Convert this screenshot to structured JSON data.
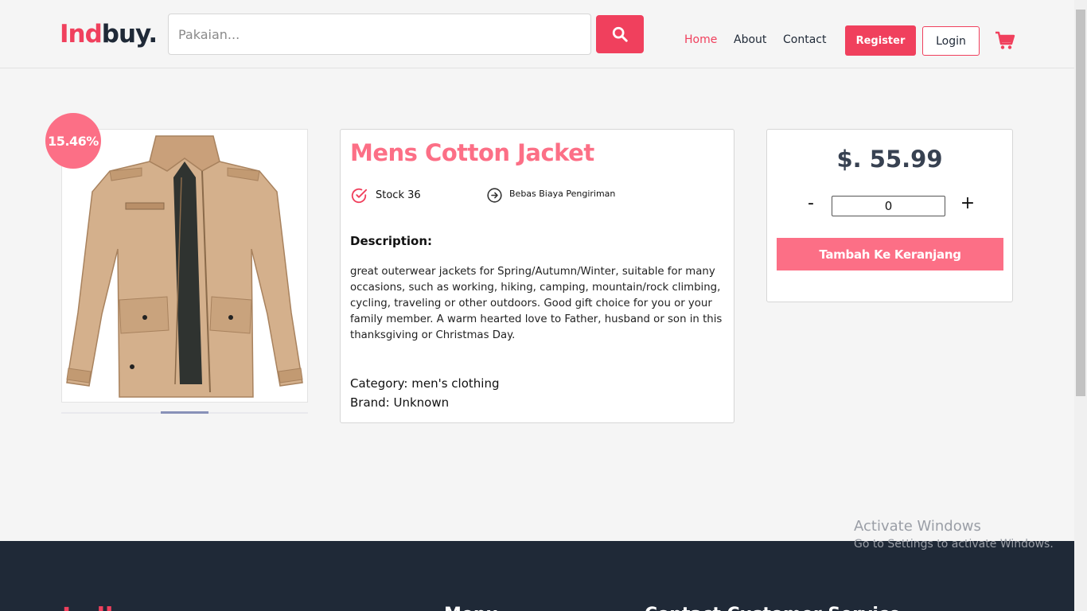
{
  "header": {
    "logo_part1": "Ind",
    "logo_part2": "buy.",
    "search_placeholder": "Pakaian...",
    "nav": [
      "Home",
      "About",
      "Contact"
    ],
    "register_label": "Register",
    "login_label": "Login"
  },
  "product": {
    "discount": "15.46%",
    "title": "Mens Cotton Jacket",
    "stock": "Stock 36",
    "shipping": "Bebas Biaya Pengiriman",
    "description_heading": "Description:",
    "description": "great outerwear jackets for Spring/Autumn/Winter, suitable for many occasions, such as working, hiking, camping, mountain/rock climbing, cycling, traveling or other outdoors. Good gift choice for you or your family member. A warm hearted love to Father, husband or son in this thanksgiving or Christmas Day.",
    "category": "Category: men's clothing",
    "brand": "Brand: Unknown"
  },
  "purchase": {
    "price": "$. 55.99",
    "minus": "-",
    "quantity": "0",
    "plus": "+",
    "add_to_cart": "Tambah Ke Keranjang"
  },
  "footer": {
    "logo": "Indbuy.",
    "heading_2": "Menu",
    "heading_3": "Contact Customer Service"
  },
  "watermark": {
    "line1": "Activate Windows",
    "line2": "Go to Settings to activate Windows."
  },
  "colors": {
    "accent": "#f0405d",
    "accent_light": "#fc6f86",
    "footer_bg": "#1f2937"
  }
}
